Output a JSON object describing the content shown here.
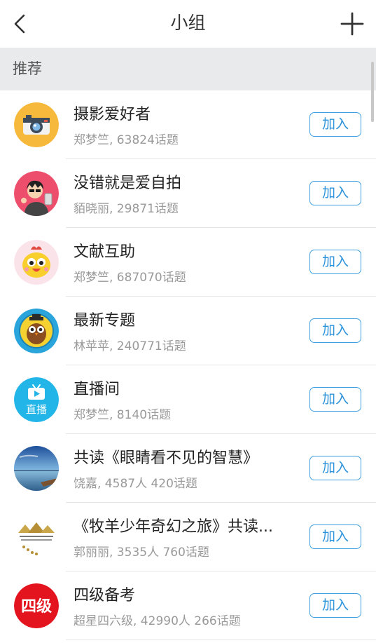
{
  "header": {
    "title": "小组",
    "back_icon": "chevron-left-icon",
    "add_icon": "plus-icon"
  },
  "section": {
    "title": "推荐"
  },
  "colors": {
    "accent": "#2d93db",
    "section_bg": "#e9eaec"
  },
  "groups": [
    {
      "name": "摄影爱好者",
      "meta": "郑梦竺, 63824话题",
      "join_label": "加入",
      "avatar_icon": "camera-icon"
    },
    {
      "name": "没错就是爱自拍",
      "meta": "貊晓丽, 29871话题",
      "join_label": "加入",
      "avatar_icon": "selfie-avatar"
    },
    {
      "name": "文献互助",
      "meta": "郑梦竺, 687070话题",
      "join_label": "加入",
      "avatar_icon": "chick-avatar"
    },
    {
      "name": "最新专题",
      "meta": "林苹苹, 240771话题",
      "join_label": "加入",
      "avatar_icon": "owl-avatar"
    },
    {
      "name": "直播间",
      "meta": "郑梦竺, 8140话题",
      "join_label": "加入",
      "avatar_icon": "tv-icon",
      "avatar_text": "直播"
    },
    {
      "name": "共读《眼睛看不见的智慧》",
      "meta": "饶嘉, 4587人 420话题",
      "join_label": "加入",
      "avatar_icon": "landscape-avatar"
    },
    {
      "name": "《牧羊少年奇幻之旅》共读...",
      "meta": "郭丽丽, 3535人 760话题",
      "join_label": "加入",
      "avatar_icon": "pyramid-avatar"
    },
    {
      "name": "四级备考",
      "meta": "超星四六级, 42990人 266话题",
      "join_label": "加入",
      "avatar_icon": "cet4-avatar",
      "avatar_text": "四级"
    }
  ]
}
